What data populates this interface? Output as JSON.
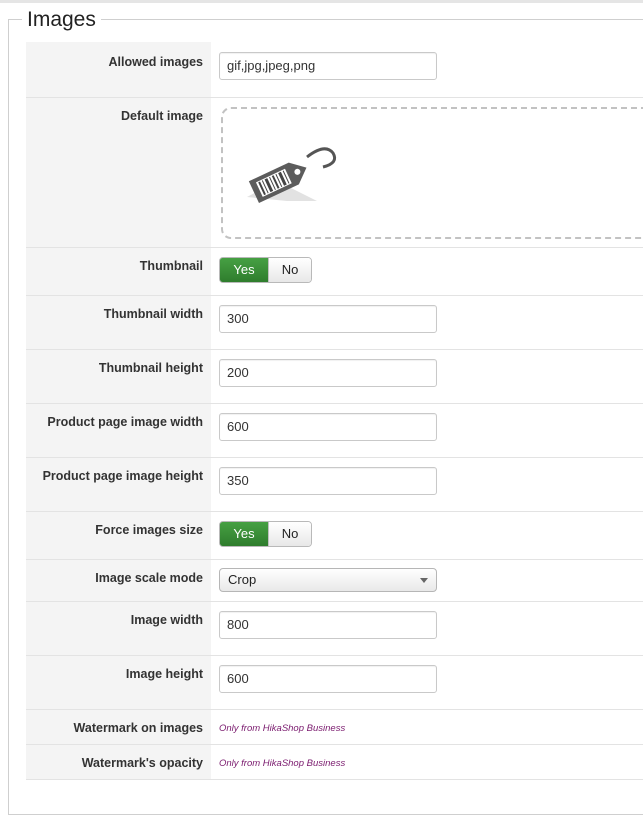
{
  "section": {
    "title": "Images"
  },
  "rows": {
    "allowed_images": {
      "label": "Allowed images",
      "value": "gif,jpg,jpeg,png"
    },
    "default_image": {
      "label": "Default image",
      "icon": "barcode-tag-icon"
    },
    "thumbnail": {
      "label": "Thumbnail",
      "yes": "Yes",
      "no": "No",
      "selected": "Yes"
    },
    "thumbnail_width": {
      "label": "Thumbnail width",
      "value": "300"
    },
    "thumbnail_height": {
      "label": "Thumbnail height",
      "value": "200"
    },
    "product_page_width": {
      "label": "Product page image width",
      "value": "600"
    },
    "product_page_height": {
      "label": "Product page image height",
      "value": "350"
    },
    "force_size": {
      "label": "Force images size",
      "yes": "Yes",
      "no": "No",
      "selected": "Yes"
    },
    "scale_mode": {
      "label": "Image scale mode",
      "value": "Crop"
    },
    "image_width": {
      "label": "Image width",
      "value": "800"
    },
    "image_height": {
      "label": "Image height",
      "value": "600"
    },
    "watermark": {
      "label": "Watermark on images",
      "note": "Only from HikaShop Business"
    },
    "watermark_opacity": {
      "label": "Watermark's opacity",
      "note": "Only from HikaShop Business"
    }
  },
  "colors": {
    "yes_active": "#3b8a38",
    "business_note": "#7a1a6e",
    "label_bg": "#f4f4f4"
  }
}
